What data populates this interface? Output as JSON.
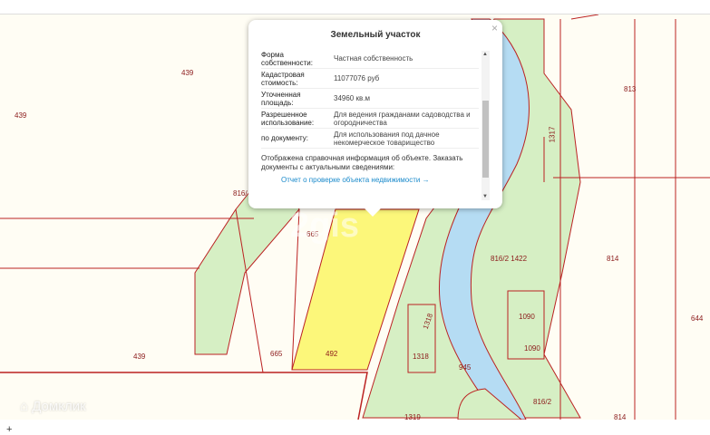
{
  "popup": {
    "title": "Земельный участок",
    "close": "×",
    "rows": [
      {
        "k": "Форма собственности:",
        "v": "Частная собственность"
      },
      {
        "k": "Кадастровая стоимость:",
        "v": "11077076 руб"
      },
      {
        "k": "Уточненная площадь:",
        "v": "34960 кв.м"
      },
      {
        "k": "Разрешенное использование:",
        "v": "Для ведения гражданами садоводства и огородничества"
      },
      {
        "k": "по документу:",
        "v": "Для использования под дачное некомерческое товарищество"
      }
    ],
    "note": "Отображена справочная информация об объекте. Заказать документы с актуальными сведениями:",
    "link": "Отчет о проверке объекта недвижимости →"
  },
  "map": {
    "labels": [
      "439",
      "439",
      "439",
      "813",
      "816/",
      "665",
      "665",
      "492",
      "1317",
      "816/2 1422",
      "814",
      "1090",
      "1090",
      "644",
      "1318",
      "1318",
      "945",
      "816/2",
      "1319",
      "814"
    ],
    "watermark": "Домклик",
    "center_watermark": "2gis"
  },
  "zoom_plus": "+"
}
